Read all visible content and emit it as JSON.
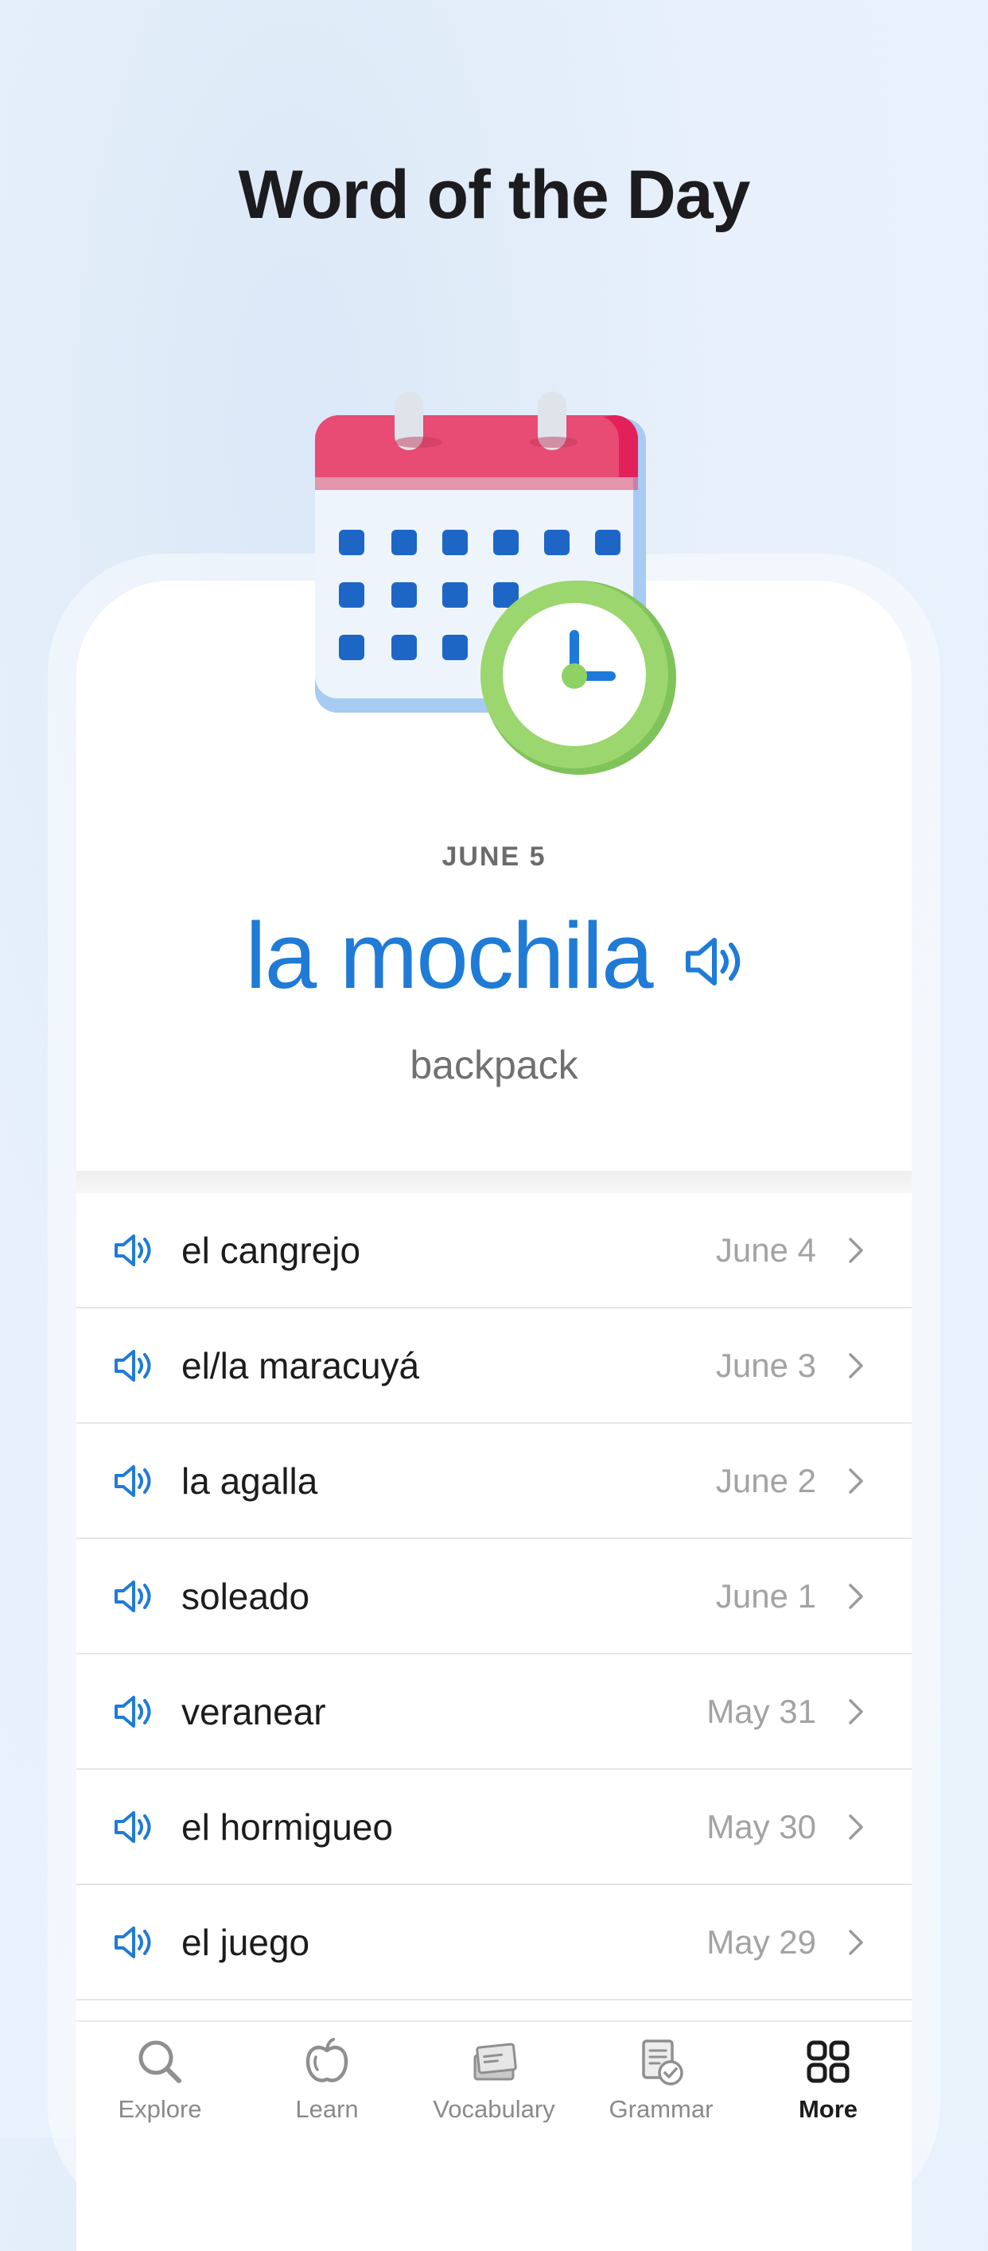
{
  "header": {
    "title": "Word of the Day"
  },
  "featured": {
    "date": "JUNE 5",
    "word": "la mochila",
    "translation": "backpack",
    "speaker_icon": "speaker-icon",
    "illustration_icon": "calendar-clock-icon"
  },
  "colors": {
    "accent": "#1f7bd6",
    "calendar_red": "#e84b73",
    "clock_green": "#8ed264"
  },
  "history": [
    {
      "word": "el cangrejo",
      "date": "June 4"
    },
    {
      "word": "el/la maracuyá",
      "date": "June 3"
    },
    {
      "word": "la agalla",
      "date": "June 2"
    },
    {
      "word": "soleado",
      "date": "June 1"
    },
    {
      "word": "veranear",
      "date": "May 31"
    },
    {
      "word": "el hormigueo",
      "date": "May 30"
    },
    {
      "word": "el juego",
      "date": "May 29"
    }
  ],
  "tabs": [
    {
      "label": "Explore",
      "icon": "search-icon",
      "active": false
    },
    {
      "label": "Learn",
      "icon": "apple-icon",
      "active": false
    },
    {
      "label": "Vocabulary",
      "icon": "flashcards-icon",
      "active": false
    },
    {
      "label": "Grammar",
      "icon": "grammar-check-icon",
      "active": false
    },
    {
      "label": "More",
      "icon": "grid-icon",
      "active": true
    }
  ]
}
